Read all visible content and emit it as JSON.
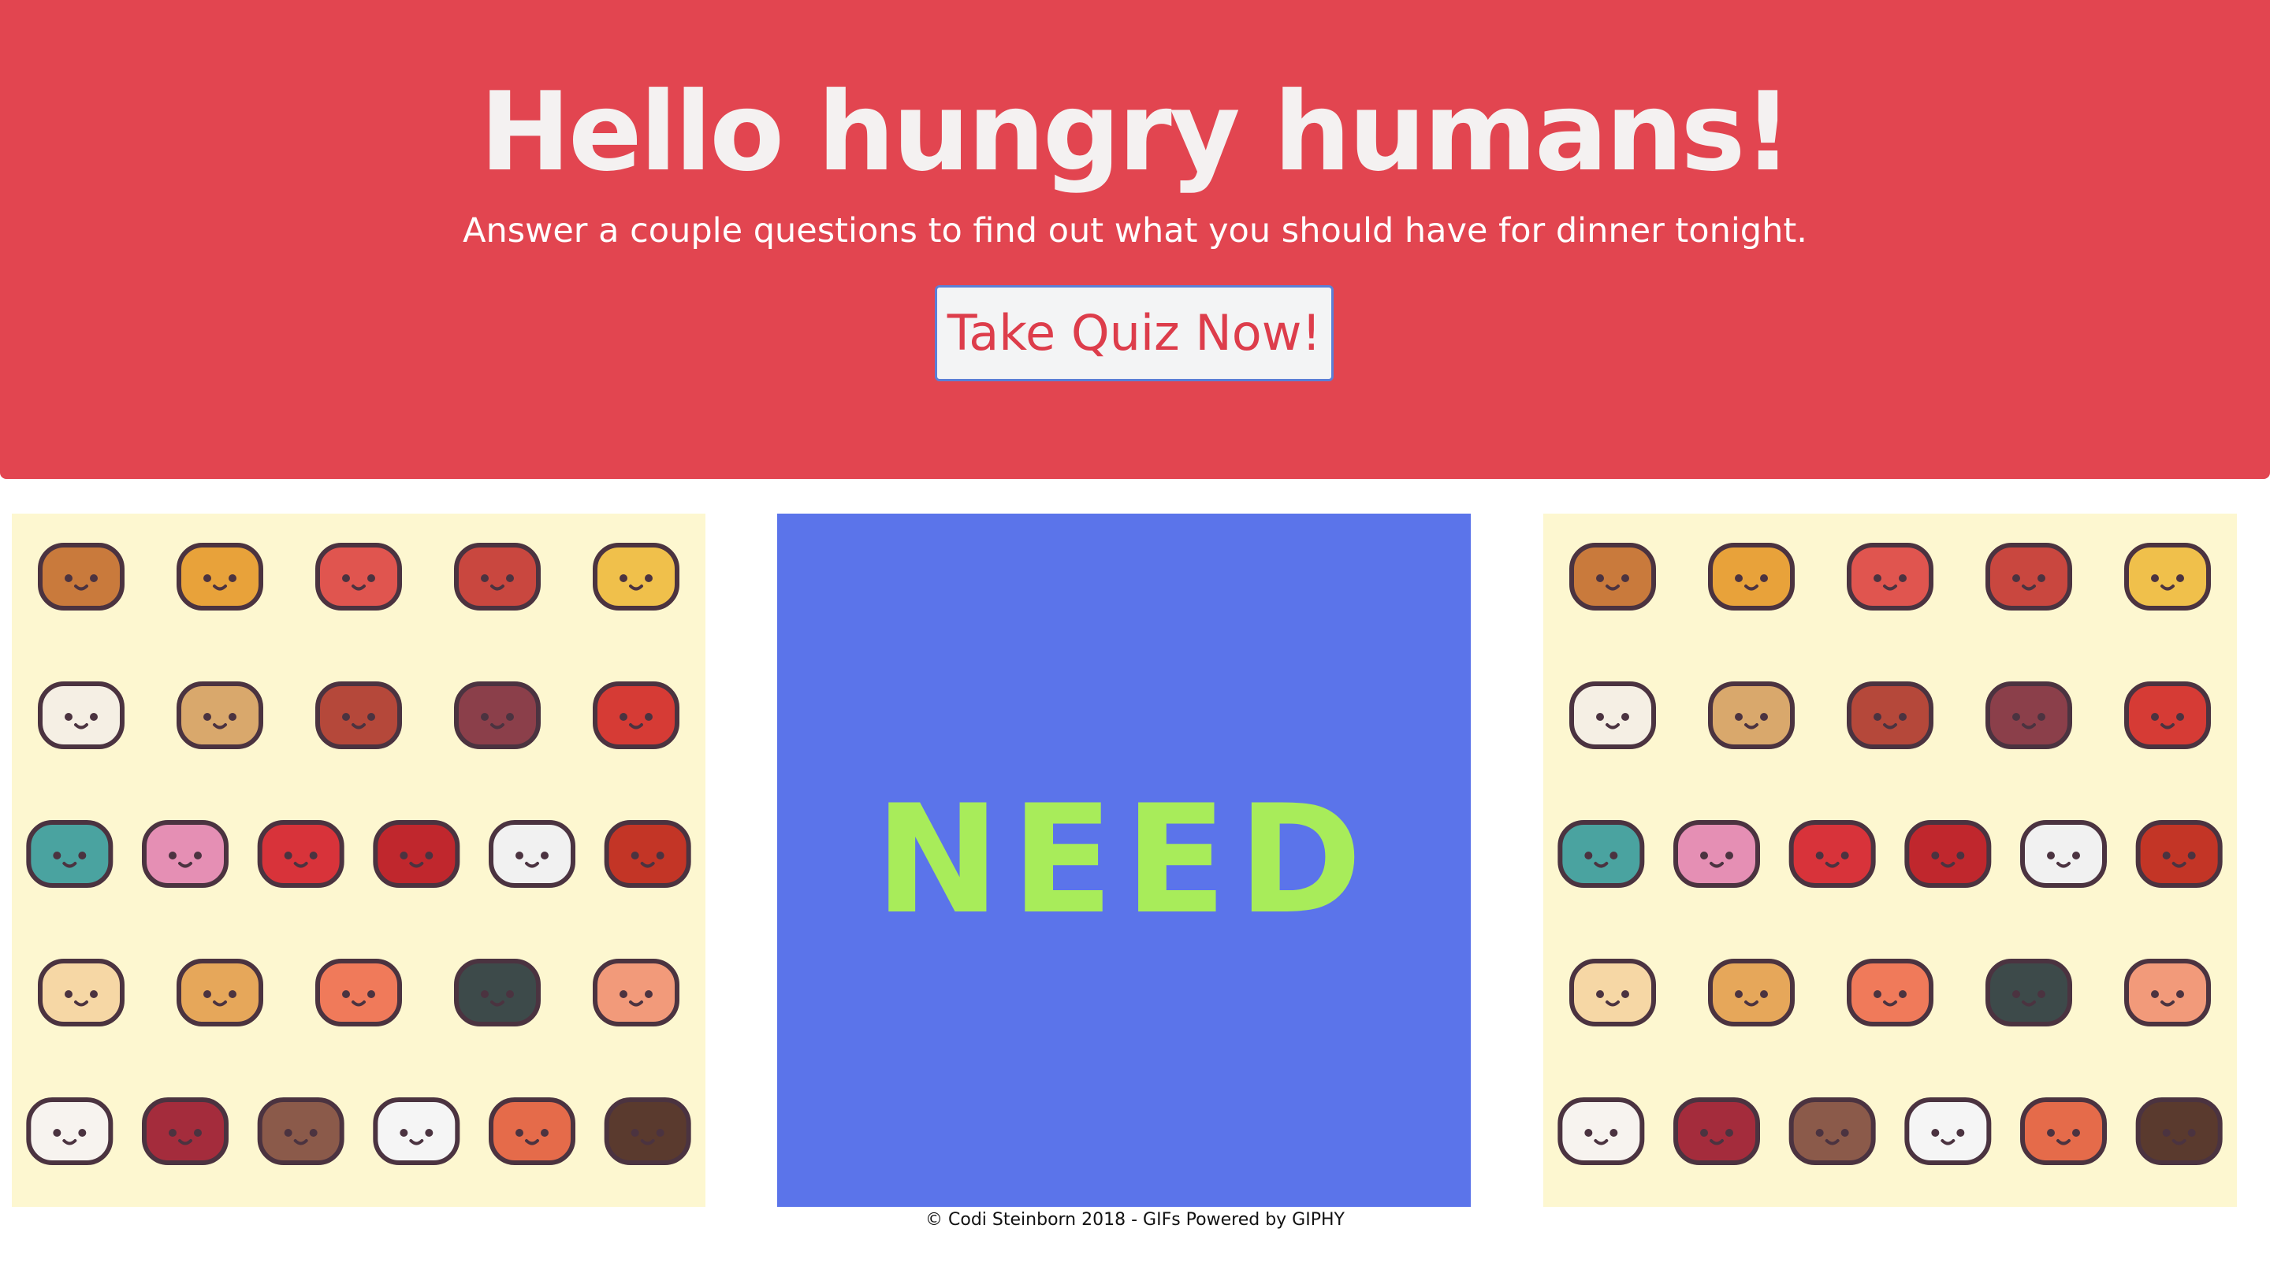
{
  "hero": {
    "title": "Hello hungry humans!",
    "subtitle": "Answer a couple questions to find out what you should have for dinner tonight.",
    "button_label": "Take Quiz Now!"
  },
  "gifs": {
    "left": {
      "icons": [
        "burger-icon",
        "taco-icon",
        "hotdog-icon",
        "drumstick-icon",
        "pizza-icon",
        "ice-cream-cone-icon",
        "bread-icon",
        "ham-icon",
        "ribs-icon",
        "hot-sauce-icon",
        "jam-jar-icon",
        "donut-icon",
        "soda-can-icon",
        "fries-icon",
        "takeout-box-icon",
        "sauce-bottle-icon",
        "ramen-icon",
        "pancakes-icon",
        "sushi-nigiri-icon",
        "sushi-roll-icon",
        "shrimp-icon",
        "ice-cream-scoop-icon",
        "syrup-bottle-icon",
        "kebab-icon",
        "coffee-mug-icon",
        "drink-can-icon",
        "ice-cream-sandwich-icon"
      ]
    },
    "center": {
      "text": "NEED"
    },
    "right": {
      "icons": [
        "burger-icon",
        "taco-icon",
        "hotdog-icon",
        "drumstick-icon",
        "pizza-icon",
        "ice-cream-cone-icon",
        "bread-icon",
        "ham-icon",
        "ribs-icon",
        "hot-sauce-icon",
        "jam-jar-icon",
        "donut-icon",
        "soda-can-icon",
        "fries-icon",
        "takeout-box-icon",
        "sauce-bottle-icon",
        "ramen-icon",
        "pancakes-icon",
        "sushi-nigiri-icon",
        "sushi-roll-icon",
        "shrimp-icon",
        "ice-cream-scoop-icon",
        "syrup-bottle-icon",
        "kebab-icon",
        "coffee-mug-icon",
        "drink-can-icon",
        "ice-cream-sandwich-icon"
      ]
    }
  },
  "footer": {
    "text": "© Codi Steinborn 2018 - GIFs Powered by GIPHY"
  },
  "colors": {
    "hero_bg": "#e24550",
    "button_text": "#dd3d4b",
    "food_bg": "#fdf7d0",
    "need_bg": "#5b74ea",
    "need_text": "#a8ec5a"
  }
}
